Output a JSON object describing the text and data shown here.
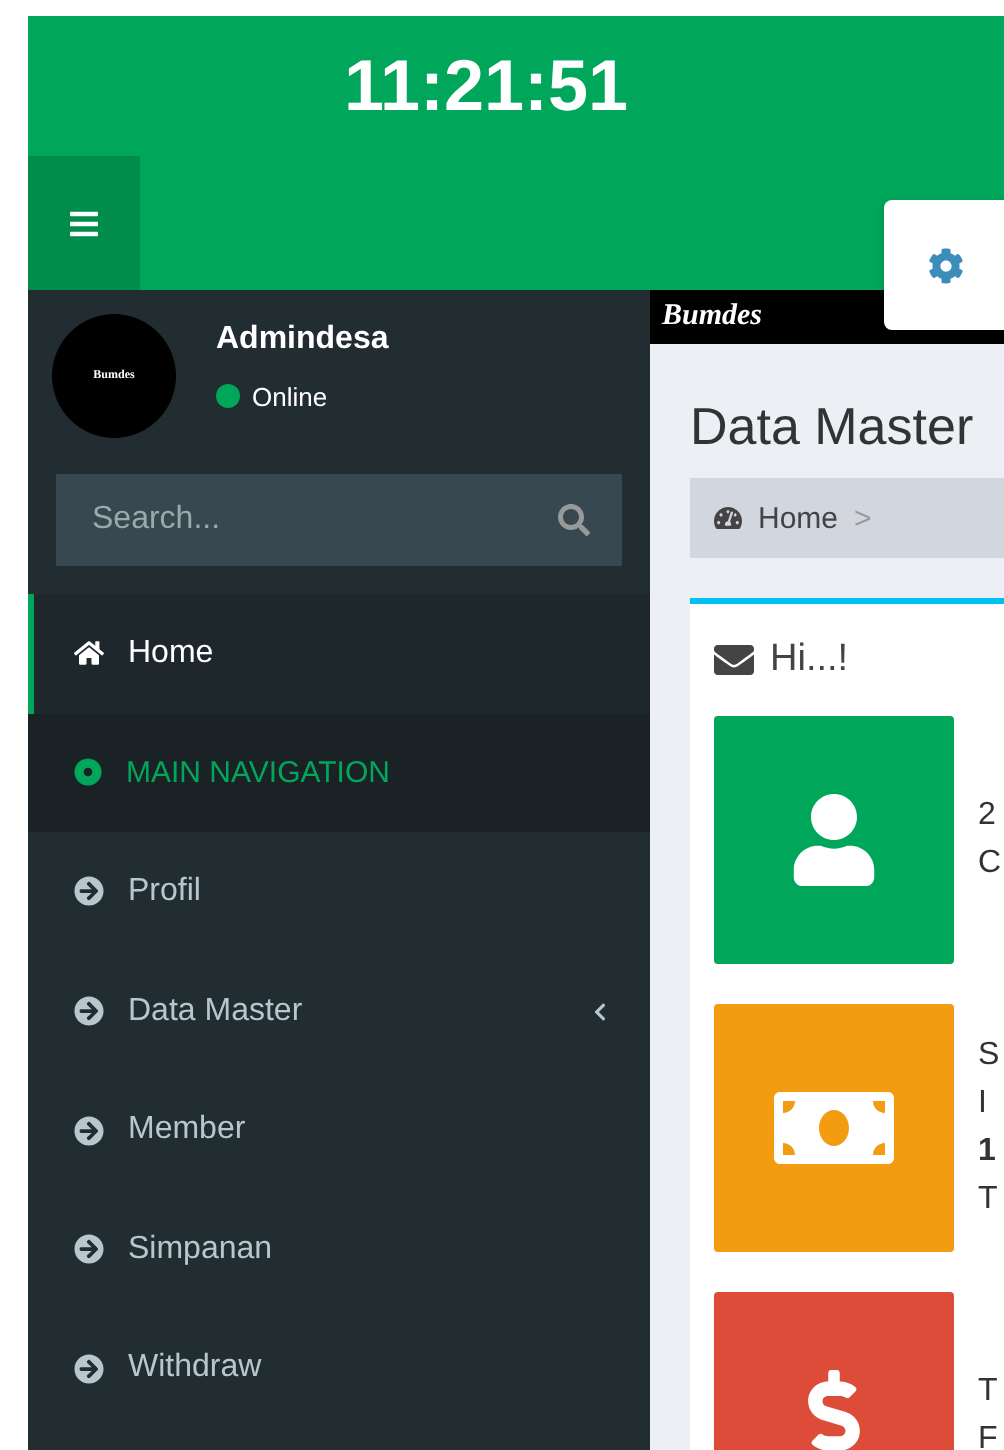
{
  "clock": "11:21:51",
  "user": {
    "name": "Admindesa",
    "avatar_text": "Bumdes",
    "status": "Online"
  },
  "search": {
    "placeholder": "Search..."
  },
  "menu": [
    {
      "kind": "home",
      "label": "Home",
      "selected": true,
      "expandable": false
    },
    {
      "kind": "header",
      "label": "MAIN NAVIGATION"
    },
    {
      "kind": "link",
      "label": "Profil",
      "selected": false,
      "expandable": false
    },
    {
      "kind": "link",
      "label": "Data Master",
      "selected": false,
      "expandable": true
    },
    {
      "kind": "link",
      "label": "Member",
      "selected": false,
      "expandable": false
    },
    {
      "kind": "link",
      "label": "Simpanan",
      "selected": false,
      "expandable": false
    },
    {
      "kind": "link",
      "label": "Withdraw",
      "selected": false,
      "expandable": false
    }
  ],
  "logo": "Bumdes",
  "page_title": "Data Master",
  "breadcrumb": [
    {
      "label": "Home",
      "separator": ">"
    }
  ],
  "box": {
    "title": "Hi...!"
  },
  "info_boxes": [
    {
      "kind": "user",
      "color": "#00a65a",
      "lines": [
        "2",
        "C"
      ]
    },
    {
      "kind": "money",
      "color": "#f39c12",
      "lines": [
        "S",
        "I",
        "1",
        "T"
      ]
    },
    {
      "kind": "dollar",
      "color": "#dd4b39",
      "lines": [
        "T",
        "F"
      ]
    }
  ]
}
